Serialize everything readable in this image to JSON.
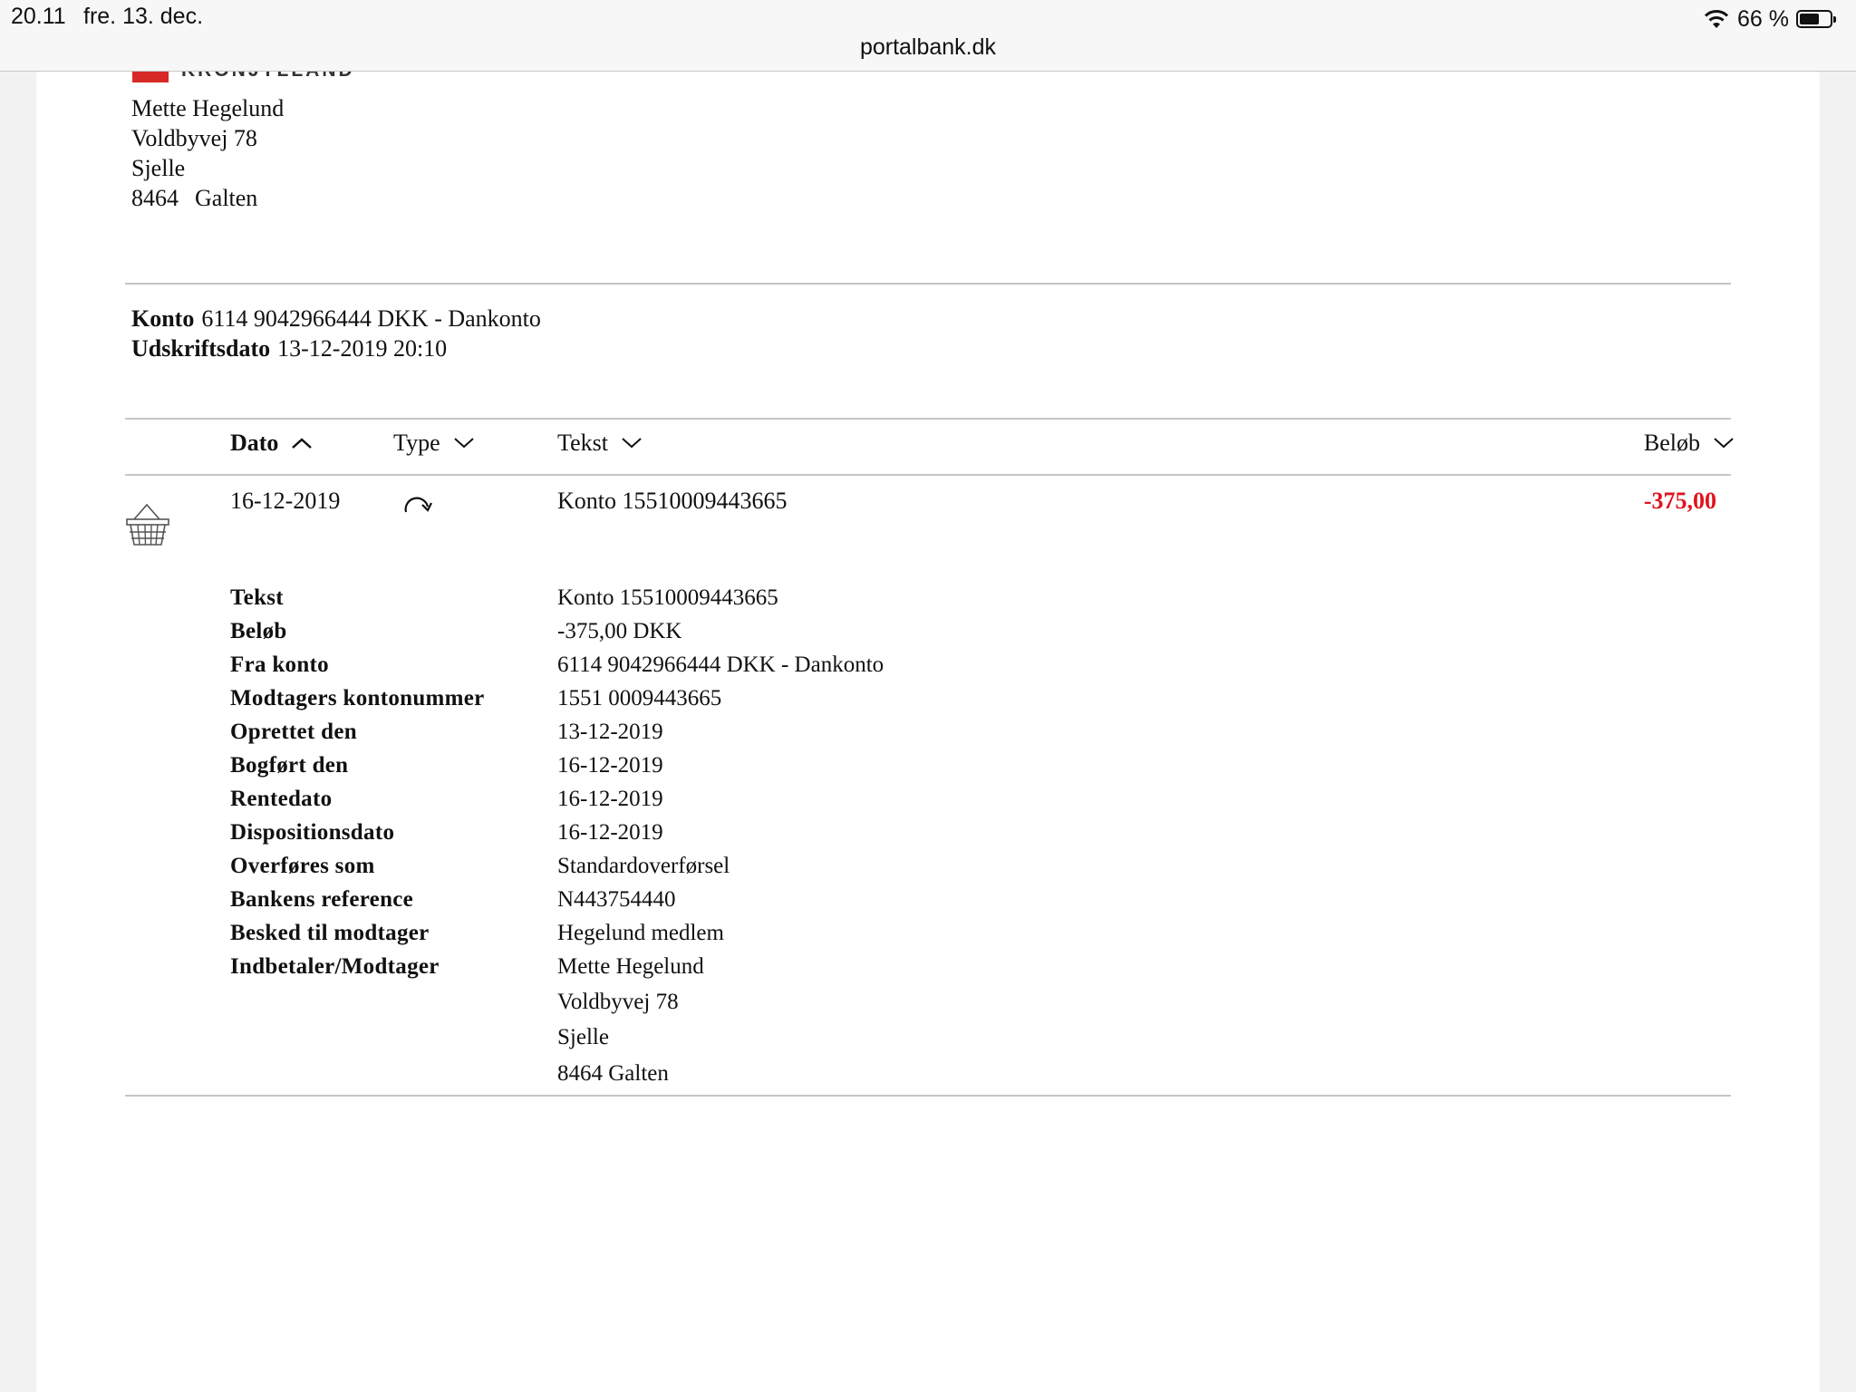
{
  "statusbar": {
    "time": "20.11",
    "date": "fre. 13. dec.",
    "url": "portalbank.dk",
    "battery_percent": "66 %",
    "battery_level": 0.66,
    "wifi_icon": "wifi-icon"
  },
  "bank": {
    "logo_text": "KRONJYLLAND",
    "brand_color": "#d72a26"
  },
  "customer": {
    "name": "Mette Hegelund",
    "street": "Voldbyvej 78",
    "town": "Sjelle",
    "zip": "8464",
    "city": "Galten"
  },
  "account": {
    "konto_label": "Konto",
    "konto_value": "6114 9042966444 DKK - Dankonto",
    "udskrift_label": "Udskriftsdato",
    "udskrift_value": "13-12-2019 20:10"
  },
  "table": {
    "headers": {
      "dato": "Dato",
      "type": "Type",
      "tekst": "Tekst",
      "belob": "Beløb"
    },
    "row": {
      "dato": "16-12-2019",
      "type_icon": "transfer-arrow-icon",
      "tekst": "Konto 15510009443665",
      "belob": "-375,00",
      "category_icon": "basket-icon",
      "negative_color": "#e0141e"
    }
  },
  "details": [
    {
      "label": "Tekst",
      "value": "Konto 15510009443665"
    },
    {
      "label": "Beløb",
      "value": "-375,00 DKK"
    },
    {
      "label": "Fra konto",
      "value": "6114 9042966444 DKK - Dankonto"
    },
    {
      "label": "Modtagers kontonummer",
      "value": "1551 0009443665"
    },
    {
      "label": "Oprettet den",
      "value": "13-12-2019"
    },
    {
      "label": "Bogført den",
      "value": "16-12-2019"
    },
    {
      "label": "Rentedato",
      "value": "16-12-2019"
    },
    {
      "label": "Dispositionsdato",
      "value": "16-12-2019"
    },
    {
      "label": "Overføres som",
      "value": "Standardoverførsel"
    },
    {
      "label": "Bankens reference",
      "value": "N443754440"
    },
    {
      "label": "Besked til modtager",
      "value": "Hegelund medlem"
    },
    {
      "label": "Indbetaler/Modtager",
      "value": "Mette Hegelund"
    }
  ],
  "payer_address": {
    "street": "Voldbyvej 78",
    "town": "Sjelle",
    "zip_city": "8464 Galten"
  }
}
